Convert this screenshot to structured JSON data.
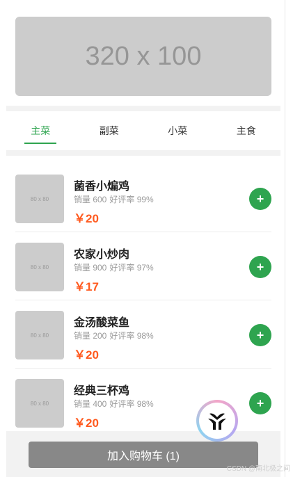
{
  "banner": {
    "text": "320 x 100"
  },
  "tabs": [
    {
      "label": "主菜",
      "active": true
    },
    {
      "label": "副菜",
      "active": false
    },
    {
      "label": "小菜",
      "active": false
    },
    {
      "label": "主食",
      "active": false
    }
  ],
  "items": [
    {
      "thumb": "80 x 80",
      "name": "菌香小煸鸡",
      "sales": "销量 600",
      "rating": "好评率 99%",
      "price": "￥20",
      "add": "+"
    },
    {
      "thumb": "80 x 80",
      "name": "农家小炒肉",
      "sales": "销量 900",
      "rating": "好评率 97%",
      "price": "￥17",
      "add": "+"
    },
    {
      "thumb": "80 x 80",
      "name": "金汤酸菜鱼",
      "sales": "销量 200",
      "rating": "好评率 98%",
      "price": "￥20",
      "add": "+"
    },
    {
      "thumb": "80 x 80",
      "name": "经典三杯鸡",
      "sales": "销量 400",
      "rating": "好评率 98%",
      "price": "￥20",
      "add": "+"
    }
  ],
  "cart_button": {
    "label": "加入购物车 (1)"
  },
  "watermark": "CSDN @南北极之间",
  "colors": {
    "accent": "#2ea44f",
    "price": "#ff5a1f",
    "button": "#888888"
  },
  "floating_icon": "y-logo-icon"
}
